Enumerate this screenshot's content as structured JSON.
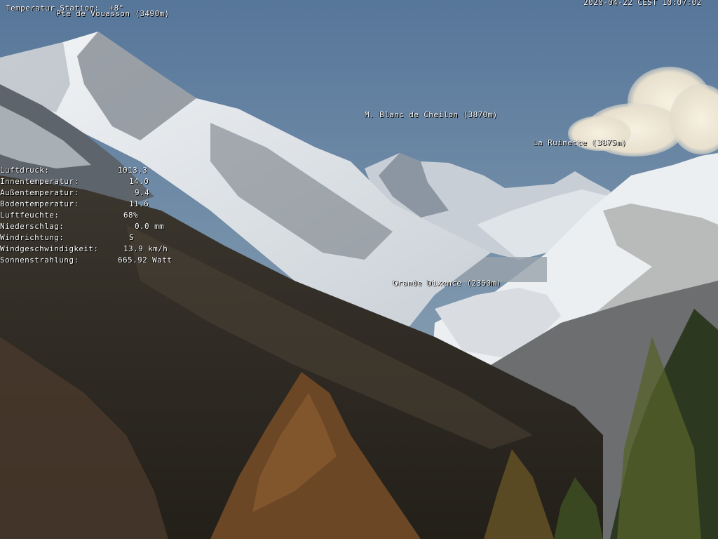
{
  "overlay": {
    "station_temp": "Temperatur Station:  +8°",
    "timestamp": "2020-04-22 CEST 10:07:02"
  },
  "peaks": {
    "vouasson": "Pte de Vouasson (3490m)",
    "cheilon": "M. Blanc de Cheilon (3870m)",
    "ruinette": "La Ruinette (3875m)",
    "dixence": "Grande Dixence (2350m)"
  },
  "weather": [
    {
      "label": "Luftdruck:",
      "value": "1013.3"
    },
    {
      "label": "Innentemperatur:",
      "value": "14.0"
    },
    {
      "label": "Außentemperatur:",
      "value": "9.4"
    },
    {
      "label": "Bodentemperatur:",
      "value": "11.6"
    },
    {
      "label": "Luftfeuchte:",
      "value": "68%"
    },
    {
      "label": "Niederschlag:",
      "value": "0.0 mm"
    },
    {
      "label": "Windrichtung:",
      "value": "S"
    },
    {
      "label": "Windgeschwindigkeit:",
      "value": "13.9 km/h"
    },
    {
      "label": "Sonnenstrahlung:",
      "value": "665.92 Watt"
    }
  ],
  "colors": {
    "sky_top": "#57779a",
    "sky_bottom": "#8ea6b6",
    "snow": "#eef2f5",
    "rock_shadow": "#5f6670",
    "forest": "#2f2a22",
    "larch": "#6b4a2a"
  }
}
